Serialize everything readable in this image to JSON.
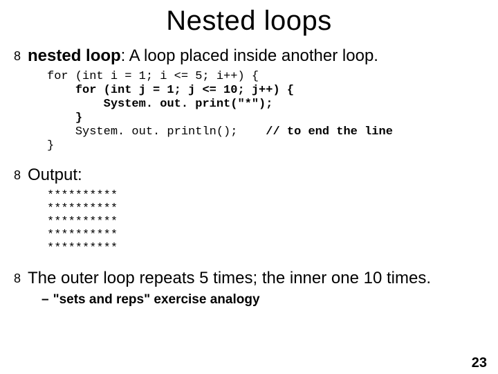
{
  "title": "Nested loops",
  "bullet_glyph": "8",
  "b1": {
    "term": "nested loop",
    "rest": ": A loop placed inside another loop."
  },
  "code": {
    "l1a": "for (int i = 1; i <= 5; i++) {",
    "l2a": "    ",
    "l2b": "for (int j = 1; j <= 10; j++) {",
    "l3a": "        ",
    "l3b": "System. out. print(\"*\");",
    "l4a": "    ",
    "l4b": "}",
    "l5a": "    ",
    "l5b": "System. out. println();    ",
    "l5c": "// to end the line",
    "l6a": "}"
  },
  "b2": "Output:",
  "output_lines": [
    "**********",
    "**********",
    "**********",
    "**********",
    "**********"
  ],
  "b3": "The outer loop repeats 5 times; the inner one 10 times.",
  "sub": {
    "dash": "–",
    "text": "\"sets and reps\" exercise analogy"
  },
  "page_number": "23"
}
